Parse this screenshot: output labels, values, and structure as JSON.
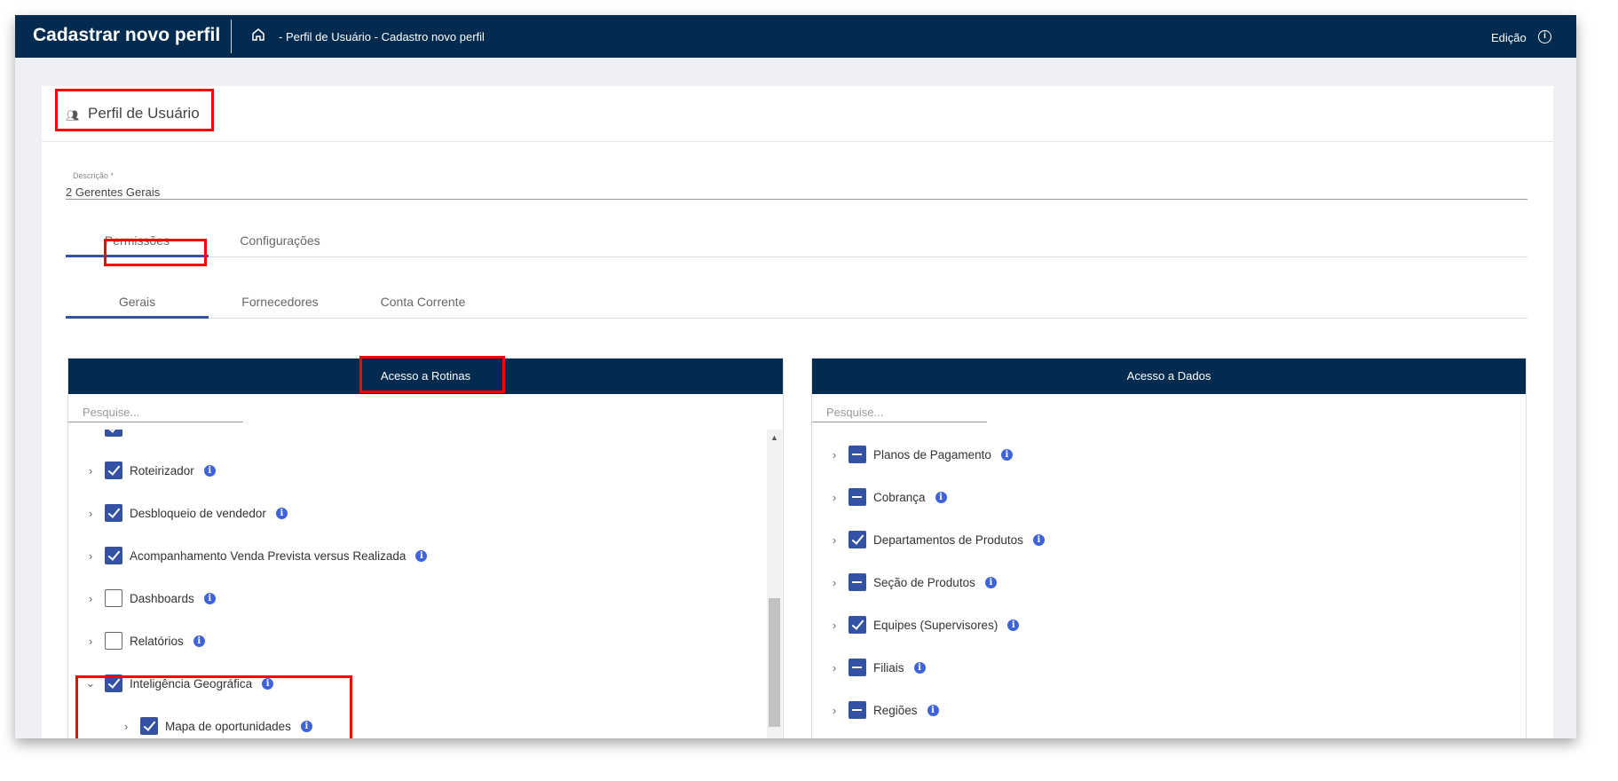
{
  "nav": {
    "title": "Cadastrar novo perfil",
    "breadcrumb": "- Perfil de Usuário - Cadastro novo perfil",
    "mode": "Edição"
  },
  "card": {
    "title": "Perfil de Usuário"
  },
  "description": {
    "label": "Descrição *",
    "value": "2  Gerentes Gerais"
  },
  "tabs": [
    "Permissões",
    "Configurações"
  ],
  "subtabs": [
    "Gerais",
    "Fornecedores",
    "Conta Corrente"
  ],
  "left_panel": {
    "title": "Acesso a Rotinas",
    "search_placeholder": "Pesquise...",
    "items": [
      {
        "label": "Roteirizador",
        "state": "checked"
      },
      {
        "label": "Desbloqueio de vendedor",
        "state": "checked"
      },
      {
        "label": "Acompanhamento Venda Prevista versus Realizada",
        "state": "checked"
      },
      {
        "label": "Dashboards",
        "state": "unchecked"
      },
      {
        "label": "Relatórios",
        "state": "unchecked"
      },
      {
        "label": "Inteligência Geográfica",
        "state": "checked",
        "expanded": true
      },
      {
        "label": "Mapa de oportunidades",
        "state": "checked",
        "child": true
      }
    ]
  },
  "right_panel": {
    "title": "Acesso a Dados",
    "search_placeholder": "Pesquise...",
    "items": [
      {
        "label": "Planos de Pagamento",
        "state": "indeterminate"
      },
      {
        "label": "Cobrança",
        "state": "indeterminate"
      },
      {
        "label": "Departamentos de Produtos",
        "state": "checked"
      },
      {
        "label": "Seção de Produtos",
        "state": "indeterminate"
      },
      {
        "label": "Equipes (Supervisores)",
        "state": "checked"
      },
      {
        "label": "Filiais",
        "state": "indeterminate"
      },
      {
        "label": "Regiões",
        "state": "indeterminate"
      }
    ]
  },
  "colors": {
    "navy": "#022b4f",
    "checkbox": "#3452a4",
    "info": "#3f63d8",
    "highlight": "#ff0000"
  }
}
